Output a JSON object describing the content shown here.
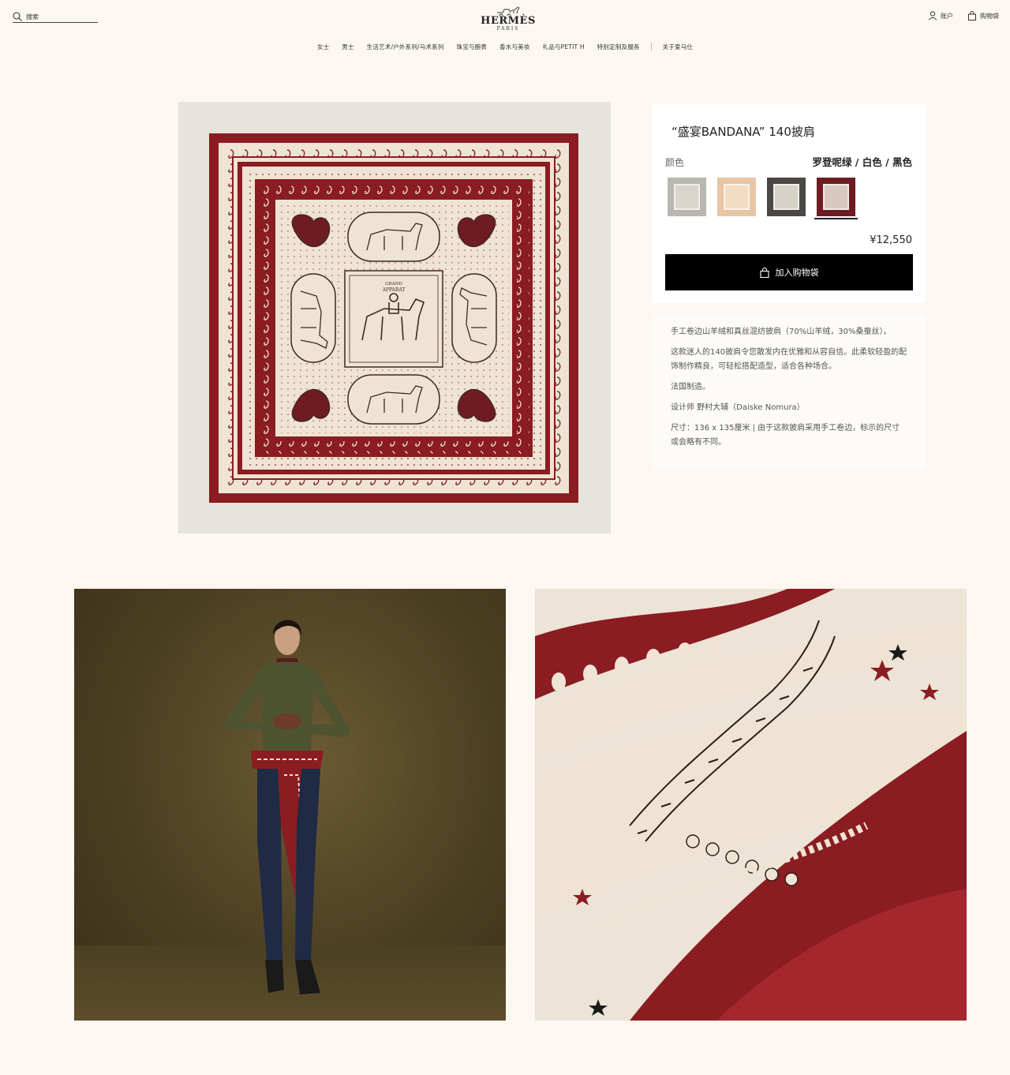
{
  "header": {
    "search_label": "搜索",
    "brand": "HERMÈS",
    "city": "PARIS",
    "account_label": "账户",
    "cart_label": "购物袋"
  },
  "nav": {
    "items": [
      "女士",
      "男士",
      "生活艺术/户外系列/马术系列",
      "珠宝与腕表",
      "香水与美妆",
      "礼品与PETIT H",
      "特别定制及服务",
      "关于爱马仕"
    ]
  },
  "product": {
    "title": "“盛宴BANDANA” 140披肩",
    "color_label": "颜色",
    "color_value": "罗登呢绿 / 白色 / 黑色",
    "swatches": [
      {
        "name": "grey",
        "outer": "#b9b8b0",
        "inner": "#d8d5cc"
      },
      {
        "name": "peach",
        "outer": "#e8c6a4",
        "inner": "#f3dcc4"
      },
      {
        "name": "charcoal",
        "outer": "#4a4845",
        "inner": "#d6d2c8"
      },
      {
        "name": "burgundy",
        "outer": "#6e1c22",
        "inner": "#d9c8bf"
      }
    ],
    "selected_swatch": 3,
    "price": "¥12,550",
    "add_to_cart": "加入购物袋"
  },
  "description": {
    "paragraphs": [
      "手工卷边山羊绒和真丝混纺披肩（70%山羊绒，30%桑蚕丝）。",
      "这款迷人的140披肩令您散发内在优雅和从容自信。此柔软轻盈的配饰制作精良，可轻松搭配造型，适合各种场合。",
      "法国制造。",
      "设计师 野村大辅（Daiske Nomura）",
      "尺寸：136 x 135厘米 | 由于这款披肩采用手工卷边，标示的尺寸或会略有不同。"
    ]
  },
  "scarf": {
    "center_text_1": "GRAND",
    "center_text_2": "APPARAT"
  },
  "colors": {
    "burgundy": "#8b1c22",
    "cream": "#efe4d4",
    "dark": "#3b2a22",
    "page_bg": "#fcf7f1"
  }
}
